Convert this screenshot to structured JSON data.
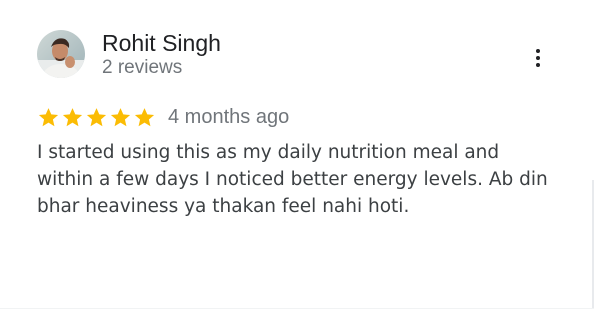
{
  "review": {
    "author_name": "Rohit Singh",
    "author_meta": "2 reviews",
    "rating": 5,
    "max_rating": 5,
    "date": "4 months ago",
    "text": "I started using this as my daily nutrition meal and within a few days I noticed better energy levels. Ab din bhar heaviness ya thakan feel nahi hoti."
  },
  "colors": {
    "star": "#fbbc04",
    "name": "#202124",
    "meta": "#70757a",
    "body": "#3c4043"
  },
  "icons": {
    "menu": "more-vert-icon",
    "star": "star-icon",
    "avatar": "avatar"
  }
}
